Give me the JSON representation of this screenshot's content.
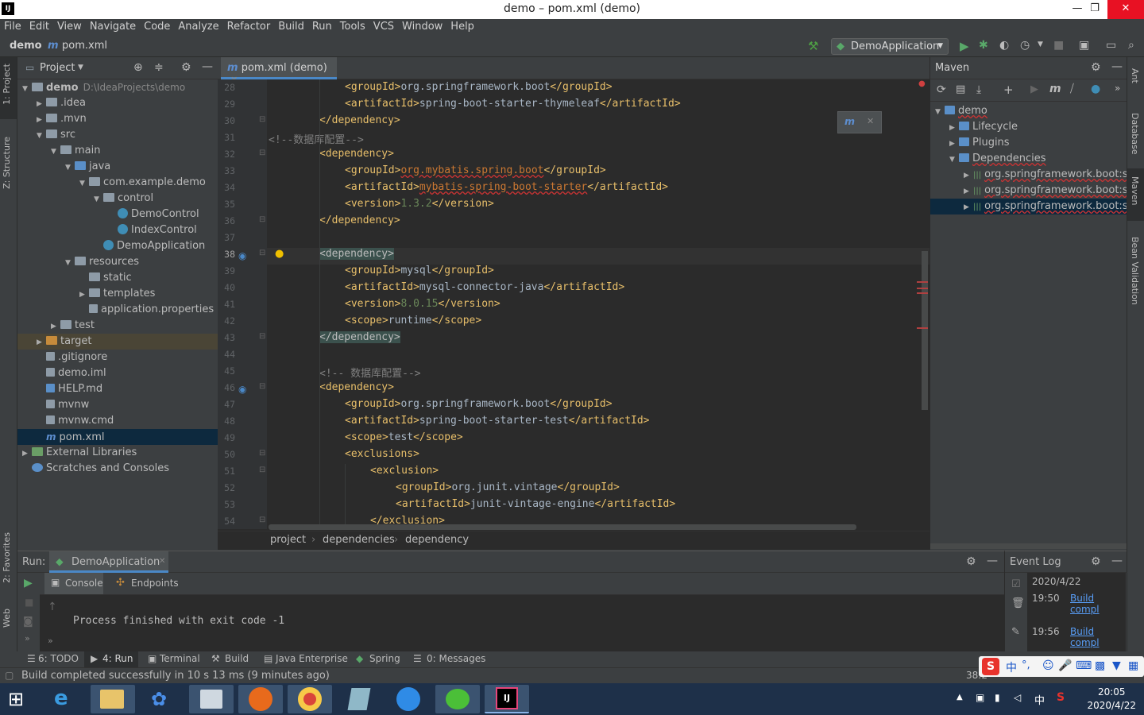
{
  "window": {
    "title": "demo – pom.xml (demo)",
    "logo": "IJ",
    "min": "—",
    "restore": "❐",
    "close": "✕"
  },
  "menu": [
    "File",
    "Edit",
    "View",
    "Navigate",
    "Code",
    "Analyze",
    "Refactor",
    "Build",
    "Run",
    "Tools",
    "VCS",
    "Window",
    "Help"
  ],
  "nav": {
    "project": "demo",
    "file": "pom.xml",
    "run_config": "DemoApplication"
  },
  "left_tabs": {
    "project": "1: Project",
    "structure": "Z: Structure",
    "favorites": "2: Favorites",
    "web": "Web"
  },
  "right_tabs": {
    "ant": "Ant",
    "database": "Database",
    "maven": "Maven",
    "bean": "Bean Validation"
  },
  "project_panel": {
    "title": "Project",
    "tree": [
      {
        "label": "demo",
        "extra": "D:\\IdeaProjects\\demo",
        "depth": 0,
        "arrow": "▼",
        "icon": "folder"
      },
      {
        "label": ".idea",
        "depth": 1,
        "arrow": "▶",
        "icon": "folder"
      },
      {
        "label": ".mvn",
        "depth": 1,
        "arrow": "▶",
        "icon": "folder"
      },
      {
        "label": "src",
        "depth": 1,
        "arrow": "▼",
        "icon": "folder"
      },
      {
        "label": "main",
        "depth": 2,
        "arrow": "▼",
        "icon": "folder"
      },
      {
        "label": "java",
        "depth": 3,
        "arrow": "▼",
        "icon": "folder-blue"
      },
      {
        "label": "com.example.demo",
        "depth": 4,
        "arrow": "▼",
        "icon": "folder"
      },
      {
        "label": "control",
        "depth": 5,
        "arrow": "▼",
        "icon": "folder"
      },
      {
        "label": "DemoControl",
        "depth": 6,
        "arrow": "",
        "icon": "class"
      },
      {
        "label": "IndexControl",
        "depth": 6,
        "arrow": "",
        "icon": "class"
      },
      {
        "label": "DemoApplication",
        "depth": 5,
        "arrow": "",
        "icon": "class"
      },
      {
        "label": "resources",
        "depth": 3,
        "arrow": "▼",
        "icon": "folder"
      },
      {
        "label": "static",
        "depth": 4,
        "arrow": "",
        "icon": "folder"
      },
      {
        "label": "templates",
        "depth": 4,
        "arrow": "▶",
        "icon": "folder"
      },
      {
        "label": "application.properties",
        "depth": 4,
        "arrow": "",
        "icon": "file"
      },
      {
        "label": "test",
        "depth": 2,
        "arrow": "▶",
        "icon": "folder"
      },
      {
        "label": "target",
        "depth": 1,
        "arrow": "▶",
        "icon": "folder-orange",
        "state": "target"
      },
      {
        "label": ".gitignore",
        "depth": 1,
        "arrow": "",
        "icon": "file"
      },
      {
        "label": "demo.iml",
        "depth": 1,
        "arrow": "",
        "icon": "file"
      },
      {
        "label": "HELP.md",
        "depth": 1,
        "arrow": "",
        "icon": "file-blue"
      },
      {
        "label": "mvnw",
        "depth": 1,
        "arrow": "",
        "icon": "file"
      },
      {
        "label": "mvnw.cmd",
        "depth": 1,
        "arrow": "",
        "icon": "file"
      },
      {
        "label": "pom.xml",
        "depth": 1,
        "arrow": "",
        "icon": "maven",
        "state": "selected"
      },
      {
        "label": "External Libraries",
        "depth": 0,
        "arrow": "▶",
        "icon": "libs"
      },
      {
        "label": "Scratches and Consoles",
        "depth": 0,
        "arrow": "",
        "icon": "scratch"
      }
    ]
  },
  "editor": {
    "tab": "pom.xml (demo)",
    "breadcrumbs": [
      "project",
      "dependencies",
      "dependency"
    ],
    "lines": [
      {
        "n": "28",
        "indent": 3,
        "parts": [
          [
            "tg",
            "<groupId>"
          ],
          [
            "tx",
            "org.springframework.boot"
          ],
          [
            "tg",
            "</groupId>"
          ]
        ]
      },
      {
        "n": "29",
        "indent": 3,
        "parts": [
          [
            "tg",
            "<artifactId>"
          ],
          [
            "tx",
            "spring-boot-starter-thymeleaf"
          ],
          [
            "tg",
            "</artifactId>"
          ]
        ]
      },
      {
        "n": "30",
        "indent": 2,
        "parts": [
          [
            "tg",
            "</dependency>"
          ]
        ]
      },
      {
        "n": "31",
        "indent": 0,
        "parts": [
          [
            "cm",
            "<!--数据库配置-->"
          ]
        ]
      },
      {
        "n": "32",
        "indent": 2,
        "parts": [
          [
            "tg",
            "<dependency>"
          ]
        ]
      },
      {
        "n": "33",
        "indent": 3,
        "parts": [
          [
            "tg",
            "<groupId>"
          ],
          [
            "err",
            "org.mybatis.spring.boot"
          ],
          [
            "tg",
            "</groupId>"
          ]
        ]
      },
      {
        "n": "34",
        "indent": 3,
        "parts": [
          [
            "tg",
            "<artifactId>"
          ],
          [
            "err",
            "mybatis-spring-boot-starter"
          ],
          [
            "tg",
            "</artifactId>"
          ]
        ]
      },
      {
        "n": "35",
        "indent": 3,
        "parts": [
          [
            "tg",
            "<version>"
          ],
          [
            "vl",
            "1.3.2"
          ],
          [
            "tg",
            "</version>"
          ]
        ]
      },
      {
        "n": "36",
        "indent": 2,
        "parts": [
          [
            "tg",
            "</dependency>"
          ]
        ]
      },
      {
        "n": "37",
        "indent": 0,
        "parts": []
      },
      {
        "n": "38",
        "indent": 2,
        "parts": [
          [
            "hl",
            "<dependency>"
          ]
        ]
      },
      {
        "n": "39",
        "indent": 3,
        "parts": [
          [
            "tg",
            "<groupId>"
          ],
          [
            "tx",
            "mysql"
          ],
          [
            "tg",
            "</groupId>"
          ]
        ]
      },
      {
        "n": "40",
        "indent": 3,
        "parts": [
          [
            "tg",
            "<artifactId>"
          ],
          [
            "tx",
            "mysql-connector-java"
          ],
          [
            "tg",
            "</artifactId>"
          ]
        ]
      },
      {
        "n": "41",
        "indent": 3,
        "parts": [
          [
            "tg",
            "<version>"
          ],
          [
            "vl",
            "8.0.15"
          ],
          [
            "tg",
            "</version>"
          ]
        ]
      },
      {
        "n": "42",
        "indent": 3,
        "parts": [
          [
            "tg",
            "<scope>"
          ],
          [
            "tx",
            "runtime"
          ],
          [
            "tg",
            "</scope>"
          ]
        ]
      },
      {
        "n": "43",
        "indent": 2,
        "parts": [
          [
            "hl",
            "</dependency>"
          ]
        ]
      },
      {
        "n": "44",
        "indent": 0,
        "parts": []
      },
      {
        "n": "45",
        "indent": 2,
        "parts": [
          [
            "cm",
            "<!-- 数据库配置-->"
          ]
        ]
      },
      {
        "n": "46",
        "indent": 2,
        "parts": [
          [
            "tg",
            "<dependency>"
          ]
        ]
      },
      {
        "n": "47",
        "indent": 3,
        "parts": [
          [
            "tg",
            "<groupId>"
          ],
          [
            "tx",
            "org.springframework.boot"
          ],
          [
            "tg",
            "</groupId>"
          ]
        ]
      },
      {
        "n": "48",
        "indent": 3,
        "parts": [
          [
            "tg",
            "<artifactId>"
          ],
          [
            "tx",
            "spring-boot-starter-test"
          ],
          [
            "tg",
            "</artifactId>"
          ]
        ]
      },
      {
        "n": "49",
        "indent": 3,
        "parts": [
          [
            "tg",
            "<scope>"
          ],
          [
            "tx",
            "test"
          ],
          [
            "tg",
            "</scope>"
          ]
        ]
      },
      {
        "n": "50",
        "indent": 3,
        "parts": [
          [
            "tg",
            "<exclusions>"
          ]
        ]
      },
      {
        "n": "51",
        "indent": 4,
        "parts": [
          [
            "tg",
            "<exclusion>"
          ]
        ]
      },
      {
        "n": "52",
        "indent": 5,
        "parts": [
          [
            "tg",
            "<groupId>"
          ],
          [
            "tx",
            "org.junit.vintage"
          ],
          [
            "tg",
            "</groupId>"
          ]
        ]
      },
      {
        "n": "53",
        "indent": 5,
        "parts": [
          [
            "tg",
            "<artifactId>"
          ],
          [
            "tx",
            "junit-vintage-engine"
          ],
          [
            "tg",
            "</artifactId>"
          ]
        ]
      },
      {
        "n": "54",
        "indent": 4,
        "parts": [
          [
            "tg",
            "</exclusion>"
          ]
        ]
      }
    ]
  },
  "maven_panel": {
    "title": "Maven",
    "tree": [
      {
        "label": "demo",
        "depth": 0,
        "arrow": "▼"
      },
      {
        "label": "Lifecycle",
        "depth": 1,
        "arrow": "▶"
      },
      {
        "label": "Plugins",
        "depth": 1,
        "arrow": "▶"
      },
      {
        "label": "Dependencies",
        "depth": 1,
        "arrow": "▼"
      },
      {
        "label": "org.springframework.boot:sp",
        "depth": 2,
        "arrow": "▶"
      },
      {
        "label": "org.springframework.boot:sp",
        "depth": 2,
        "arrow": "▶"
      },
      {
        "label": "org.springframework.boot:sp",
        "depth": 2,
        "arrow": "▶",
        "selected": true
      }
    ]
  },
  "run_panel": {
    "label": "Run:",
    "tab": "DemoApplication",
    "console_tab": "Console",
    "endpoints_tab": "Endpoints",
    "output": "Process finished with exit code -1"
  },
  "event_log": {
    "title": "Event Log",
    "date": "2020/4/22",
    "entries": [
      {
        "time": "19:50",
        "text": "Build compl"
      },
      {
        "time": "19:56",
        "text": "Build compl"
      }
    ]
  },
  "tool_windows": [
    {
      "label": "6: TODO",
      "icon": "list-icon"
    },
    {
      "label": "4: Run",
      "icon": "run-icon"
    },
    {
      "label": "Terminal",
      "icon": "terminal-icon"
    },
    {
      "label": "Build",
      "icon": "hammer-icon"
    },
    {
      "label": "Java Enterprise",
      "icon": "enterprise-icon"
    },
    {
      "label": "Spring",
      "icon": "spring-icon"
    },
    {
      "label": "0: Messages",
      "icon": "messages-icon"
    }
  ],
  "status": {
    "message": "Build completed successfully in 10 s 13 ms (9 minutes ago)",
    "position": "38:2"
  },
  "ime": {
    "lang": "中",
    "punct": "°,",
    "mode": "中"
  },
  "taskbar": {
    "time": "20:05",
    "date": "2020/4/22"
  }
}
